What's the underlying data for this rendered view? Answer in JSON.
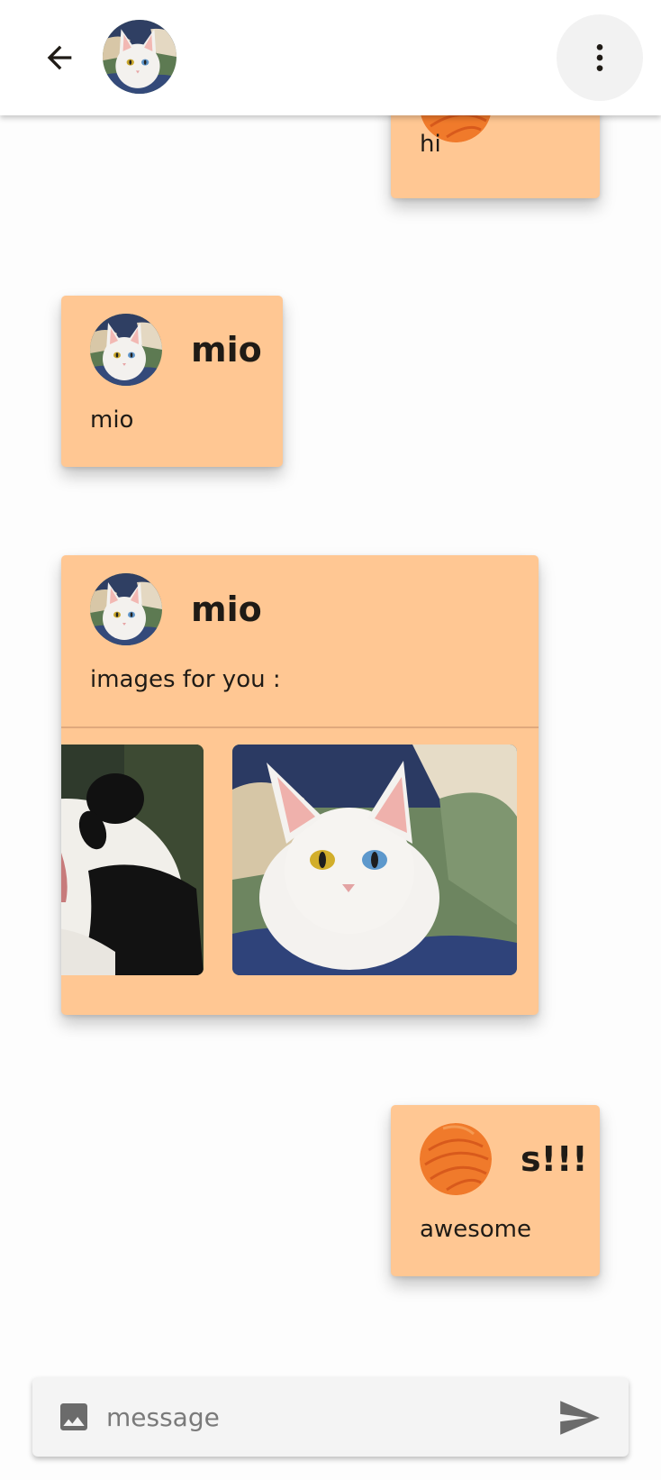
{
  "header": {
    "back_icon": "arrow-back-icon",
    "avatar": "cat-avatar",
    "menu_icon": "more-vert-icon"
  },
  "messages": [
    {
      "name": "",
      "text": "hi",
      "side": "right",
      "avatar": "orange-ball-avatar"
    },
    {
      "name": "mio",
      "text": "mio",
      "side": "left",
      "avatar": "cat-avatar"
    },
    {
      "name": "mio",
      "text": "images for you :",
      "side": "left",
      "avatar": "cat-avatar",
      "images": [
        "panda-photo",
        "white-cat-photo"
      ]
    },
    {
      "name": "s!!!",
      "text": "awesome",
      "side": "right",
      "avatar": "orange-ball-avatar"
    }
  ],
  "composer": {
    "placeholder": "message",
    "value": "",
    "image_icon": "image-icon",
    "send_icon": "send-icon"
  },
  "colors": {
    "bubble": "#ffc793",
    "background": "#fdfdfd",
    "accent_orange": "#f07a2b"
  }
}
